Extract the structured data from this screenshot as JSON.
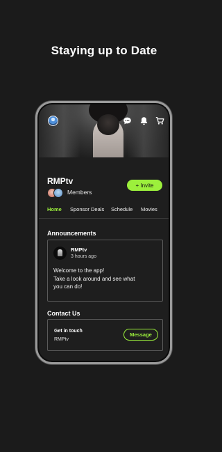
{
  "headline": "Staying up to Date",
  "top_icons": [
    "profile-avatar",
    "chat-icon",
    "bell-icon",
    "cart-icon"
  ],
  "group": {
    "name": "RMPtv",
    "members_label": "Members",
    "invite_label": "+ Invite"
  },
  "tabs": [
    {
      "label": "Home",
      "active": true
    },
    {
      "label": "Sponsor Deals",
      "active": false
    },
    {
      "label": "Schedule",
      "active": false
    },
    {
      "label": "Movies",
      "active": false
    }
  ],
  "announcements": {
    "title": "Announcements",
    "post": {
      "author": "RMPtv",
      "time": "3 hours ago",
      "lines": [
        "Welcome to the app!",
        "Take a look around and see what",
        "you can do!"
      ]
    }
  },
  "contact": {
    "title": "Contact Us",
    "label": "Get in touch",
    "name": "RMPtv",
    "button_label": "Message"
  },
  "colors": {
    "accent": "#9cf03c",
    "background": "#1b1b1b",
    "screen": "#1e1e1e"
  }
}
